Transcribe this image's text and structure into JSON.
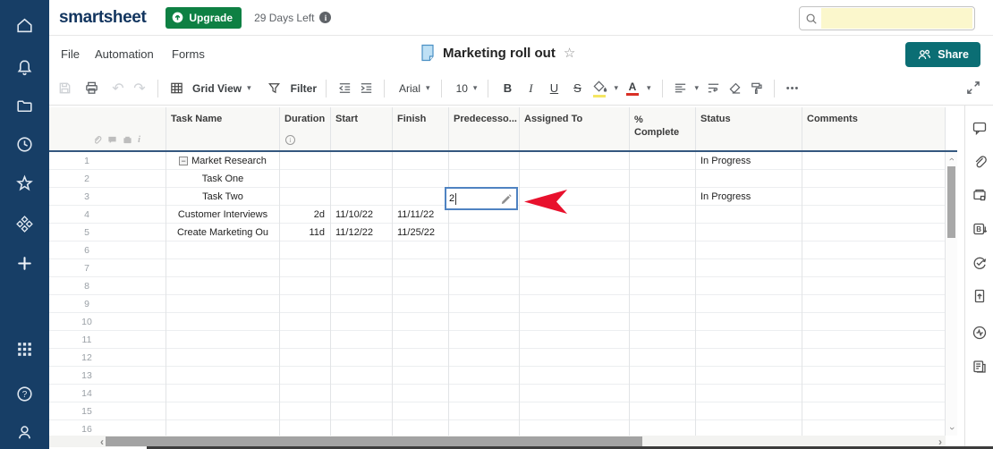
{
  "topbar": {
    "logo": "smartsheet",
    "upgrade_label": "Upgrade",
    "trial_text": "29 Days Left",
    "trial_info": "i",
    "search_value": ""
  },
  "menubar": {
    "items": [
      "File",
      "Automation",
      "Forms"
    ],
    "sheet_title": "Marketing roll out",
    "share_label": "Share"
  },
  "toolbar": {
    "view_label": "Grid View",
    "filter_label": "Filter",
    "font_family_value": "Arial",
    "font_size_value": "10",
    "bold_label": "B",
    "italic_label": "I",
    "underline_label": "U",
    "strikethrough_label": "S",
    "text_color_label": "A",
    "more_label": "•••"
  },
  "icons": {
    "caret_down": "▾",
    "undo": "↶",
    "redo": "↷",
    "star_outline": "☆",
    "collapse_minus": "−",
    "chevron": "›",
    "chevron_left": "‹",
    "duration_info": "i"
  },
  "grid": {
    "columns": [
      "Task Name",
      "Duration",
      "Start",
      "Finish",
      "Predecesso...",
      "Assigned To",
      "% Complete",
      "Status",
      "Comments"
    ],
    "edit": {
      "value": "2"
    },
    "rows": [
      {
        "num": "1",
        "task": "Market Research",
        "collapse": true,
        "status": "In Progress"
      },
      {
        "num": "2",
        "task": "Task One"
      },
      {
        "num": "3",
        "task": "Task Two",
        "status": "In Progress"
      },
      {
        "num": "4",
        "task": "Customer Interviews",
        "duration": "2d",
        "start": "11/10/22",
        "finish": "11/11/22"
      },
      {
        "num": "5",
        "task": "Create Marketing Ou",
        "duration": "11d",
        "start": "11/12/22",
        "finish": "11/25/22"
      },
      {
        "num": "6"
      },
      {
        "num": "7"
      },
      {
        "num": "8"
      },
      {
        "num": "9"
      },
      {
        "num": "10"
      },
      {
        "num": "11"
      },
      {
        "num": "12"
      },
      {
        "num": "13"
      },
      {
        "num": "14"
      },
      {
        "num": "15"
      },
      {
        "num": "16"
      }
    ]
  },
  "colors": {
    "sidebar": "#173e66",
    "upgrade_green": "#0e8043",
    "share_teal": "#0b6e74",
    "search_highlight": "#fbf7cc",
    "arrow_red": "#e8112d",
    "edit_border": "#4f83c2"
  }
}
